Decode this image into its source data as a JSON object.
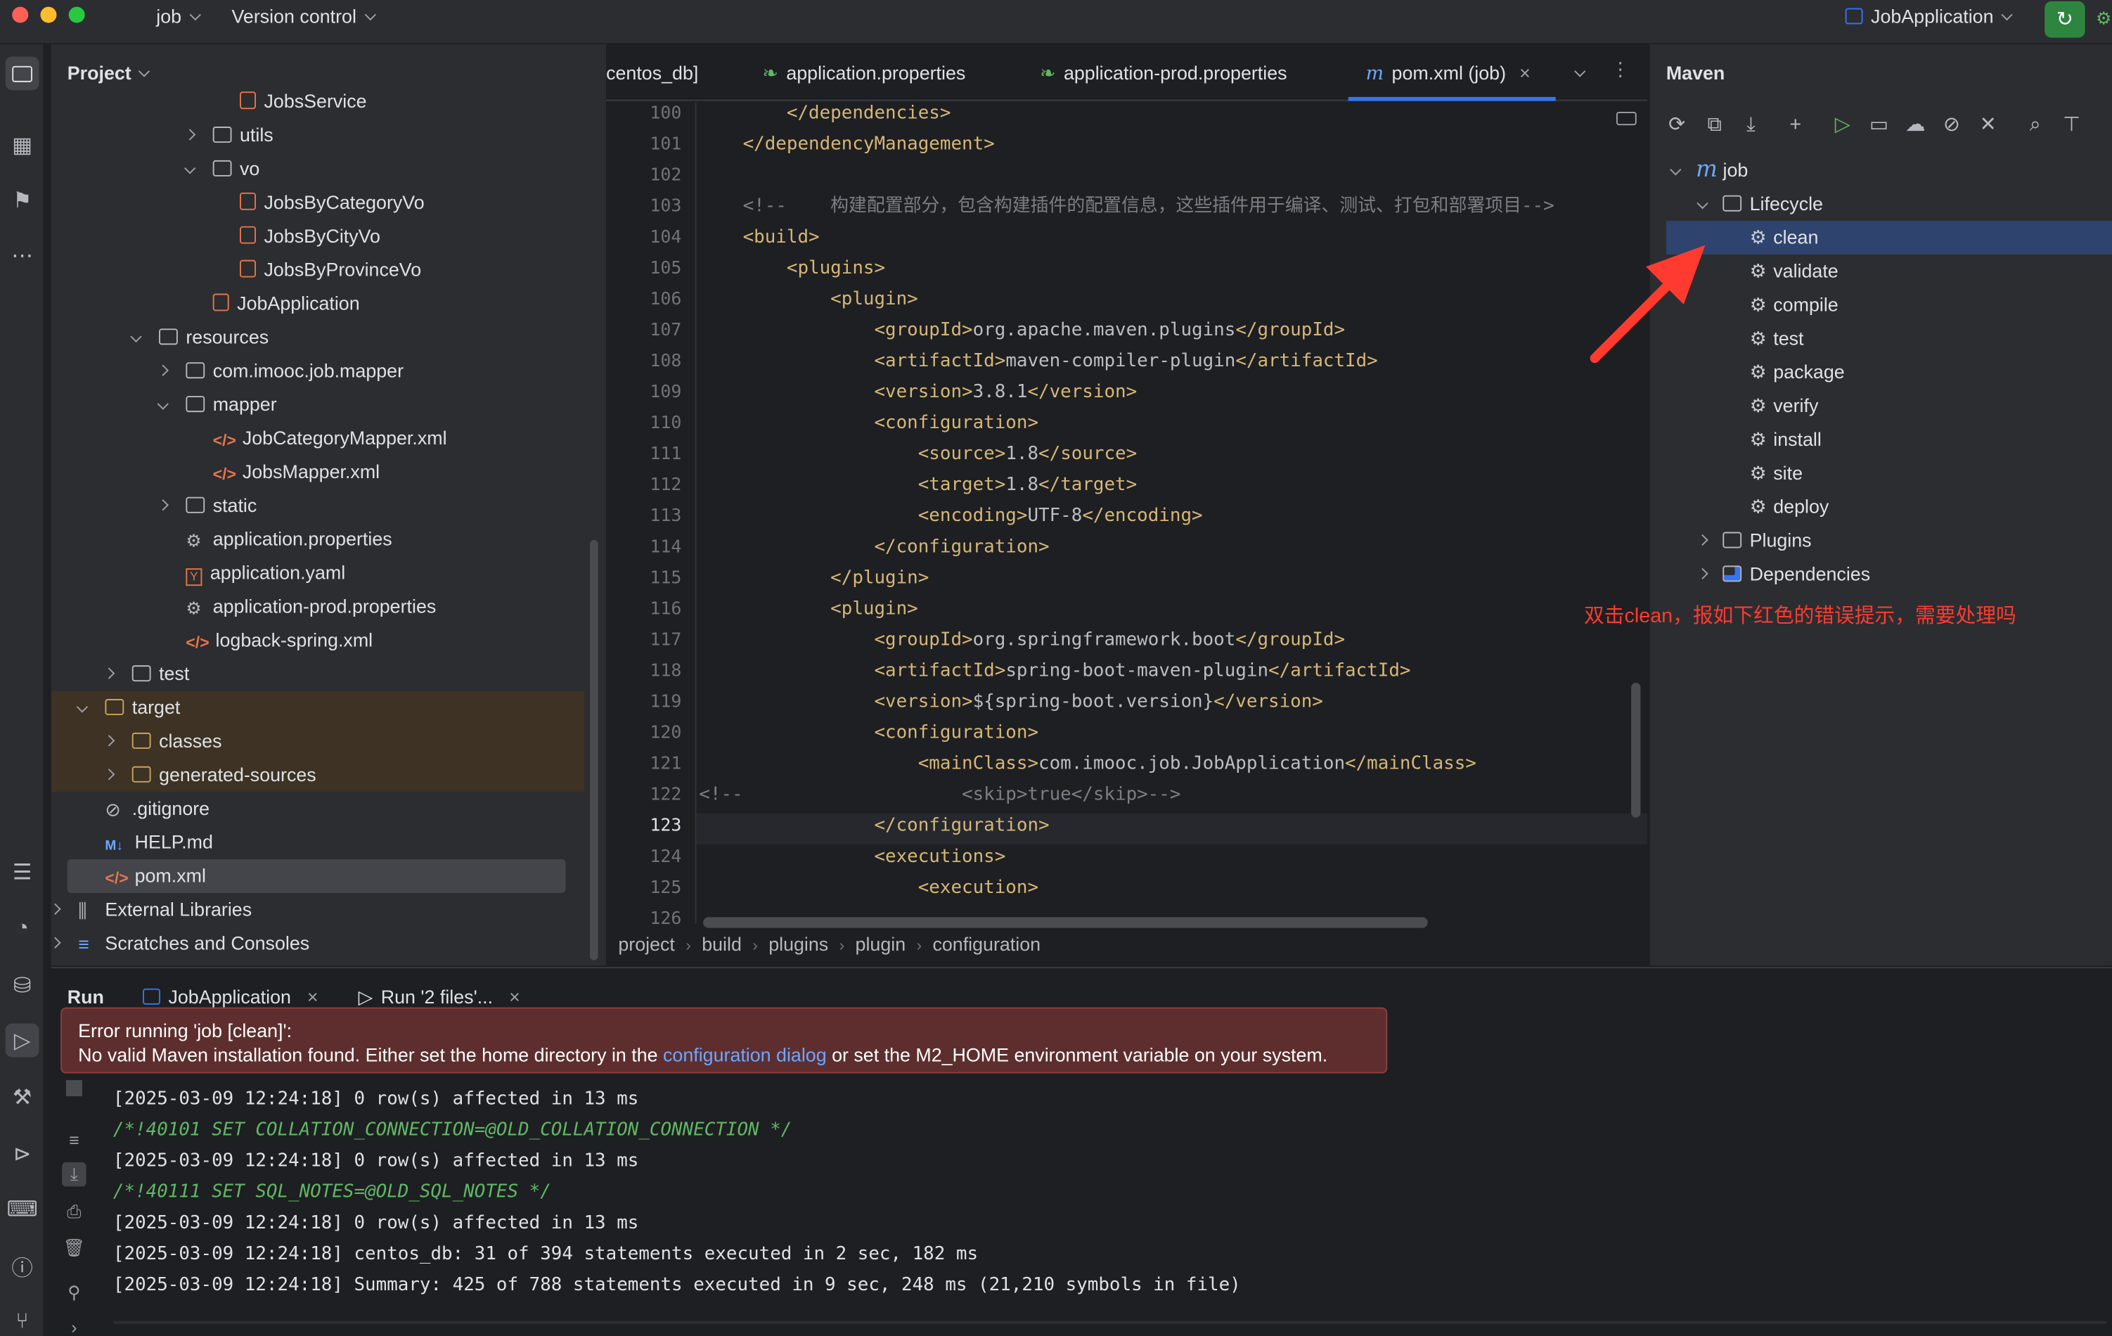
{
  "titlebar": {
    "project_name": "job",
    "vcs_label": "Version control",
    "run_config": "JobApplication"
  },
  "project_panel": {
    "title": "Project",
    "items": [
      {
        "label": "JobsService",
        "type": "java",
        "indent": 7
      },
      {
        "label": "utils",
        "type": "folder",
        "indent": 6,
        "arrow": "right"
      },
      {
        "label": "vo",
        "type": "folder",
        "indent": 6,
        "arrow": "down"
      },
      {
        "label": "JobsByCategoryVo",
        "type": "java",
        "indent": 7
      },
      {
        "label": "JobsByCityVo",
        "type": "java",
        "indent": 7
      },
      {
        "label": "JobsByProvinceVo",
        "type": "java",
        "indent": 7
      },
      {
        "label": "JobApplication",
        "type": "java",
        "indent": 6
      },
      {
        "label": "resources",
        "type": "folder",
        "indent": 4,
        "arrow": "down"
      },
      {
        "label": "com.imooc.job.mapper",
        "type": "folder",
        "indent": 5,
        "arrow": "right"
      },
      {
        "label": "mapper",
        "type": "folder",
        "indent": 5,
        "arrow": "down"
      },
      {
        "label": "JobCategoryMapper.xml",
        "type": "xml",
        "indent": 6
      },
      {
        "label": "JobsMapper.xml",
        "type": "xml",
        "indent": 6
      },
      {
        "label": "static",
        "type": "folder",
        "indent": 5,
        "arrow": "right"
      },
      {
        "label": "application.properties",
        "type": "gear",
        "indent": 5
      },
      {
        "label": "application.yaml",
        "type": "yaml",
        "indent": 5
      },
      {
        "label": "application-prod.properties",
        "type": "gear",
        "indent": 5
      },
      {
        "label": "logback-spring.xml",
        "type": "xml",
        "indent": 5
      },
      {
        "label": "test",
        "type": "folder",
        "indent": 3,
        "arrow": "right"
      },
      {
        "label": "target",
        "type": "folder-o",
        "indent": 2,
        "arrow": "down",
        "highlight": true
      },
      {
        "label": "classes",
        "type": "folder-o",
        "indent": 3,
        "arrow": "right",
        "highlight": true
      },
      {
        "label": "generated-sources",
        "type": "folder-o",
        "indent": 3,
        "arrow": "right",
        "highlight": true
      },
      {
        "label": ".gitignore",
        "type": "ignore",
        "indent": 2
      },
      {
        "label": "HELP.md",
        "type": "md",
        "indent": 2
      },
      {
        "label": "pom.xml",
        "type": "xml",
        "indent": 2,
        "selected": true
      },
      {
        "label": "External Libraries",
        "type": "lib",
        "indent": 1,
        "arrow": "right"
      },
      {
        "label": "Scratches and Consoles",
        "type": "scratch",
        "indent": 1,
        "arrow": "right"
      }
    ]
  },
  "editor": {
    "tabs": [
      {
        "label": "centos_db]"
      },
      {
        "label": "application.properties"
      },
      {
        "label": "application-prod.properties"
      },
      {
        "label": "pom.xml (job)",
        "active": true
      }
    ],
    "lines": [
      {
        "n": "100",
        "text": "        </dependencies>"
      },
      {
        "n": "101",
        "text": "    </dependencyManagement>"
      },
      {
        "n": "102",
        "text": ""
      },
      {
        "n": "103",
        "text": "    <!--    构建配置部分，包含构建插件的配置信息，这些插件用于编译、测试、打包和部署项目-->"
      },
      {
        "n": "104",
        "text": "    <build>"
      },
      {
        "n": "105",
        "text": "        <plugins>"
      },
      {
        "n": "106",
        "text": "            <plugin>"
      },
      {
        "n": "107",
        "text": "                <groupId>org.apache.maven.plugins</groupId>"
      },
      {
        "n": "108",
        "text": "                <artifactId>maven-compiler-plugin</artifactId>"
      },
      {
        "n": "109",
        "text": "                <version>3.8.1</version>"
      },
      {
        "n": "110",
        "text": "                <configuration>"
      },
      {
        "n": "111",
        "text": "                    <source>1.8</source>"
      },
      {
        "n": "112",
        "text": "                    <target>1.8</target>"
      },
      {
        "n": "113",
        "text": "                    <encoding>UTF-8</encoding>"
      },
      {
        "n": "114",
        "text": "                </configuration>"
      },
      {
        "n": "115",
        "text": "            </plugin>"
      },
      {
        "n": "116",
        "text": "            <plugin>"
      },
      {
        "n": "117",
        "text": "                <groupId>org.springframework.boot</groupId>"
      },
      {
        "n": "118",
        "text": "                <artifactId>spring-boot-maven-plugin</artifactId>"
      },
      {
        "n": "119",
        "text": "                <version>${spring-boot.version}</version>"
      },
      {
        "n": "120",
        "text": "                <configuration>"
      },
      {
        "n": "121",
        "text": "                    <mainClass>com.imooc.job.JobApplication</mainClass>"
      },
      {
        "n": "122",
        "text": "<!--                    <skip>true</skip>-->"
      },
      {
        "n": "123",
        "text": "                </configuration>"
      },
      {
        "n": "124",
        "text": "                <executions>"
      },
      {
        "n": "125",
        "text": "                    <execution>"
      },
      {
        "n": "126",
        "text": ""
      }
    ],
    "breadcrumb": [
      "project",
      "build",
      "plugins",
      "plugin",
      "configuration"
    ]
  },
  "maven": {
    "title": "Maven",
    "root": "job",
    "lifecycle_label": "Lifecycle",
    "goals": [
      "clean",
      "validate",
      "compile",
      "test",
      "package",
      "verify",
      "install",
      "site",
      "deploy"
    ],
    "plugins_label": "Plugins",
    "dependencies_label": "Dependencies",
    "annotation": "双击clean，报如下红色的错误提示，需要处理吗"
  },
  "run_panel": {
    "title": "Run",
    "tabs": [
      "JobApplication",
      "Run '2 files'..."
    ],
    "error_title": "Error running 'job [clean]':",
    "error_msg_before": "No valid Maven installation found. Either set the home directory in the ",
    "error_link": "configuration dialog",
    "error_msg_after": " or set the M2_HOME environment variable on your system.",
    "output": [
      {
        "text": "[2025-03-09 12:24:18] 0 row(s) affected in 13 ms",
        "kind": "log"
      },
      {
        "text": "/*!40101 SET COLLATION_CONNECTION=@OLD_COLLATION_CONNECTION */",
        "kind": "sql"
      },
      {
        "text": "[2025-03-09 12:24:18] 0 row(s) affected in 13 ms",
        "kind": "log"
      },
      {
        "text": "/*!40111 SET SQL_NOTES=@OLD_SQL_NOTES */",
        "kind": "sql"
      },
      {
        "text": "[2025-03-09 12:24:18] 0 row(s) affected in 13 ms",
        "kind": "log"
      },
      {
        "text": "[2025-03-09 12:24:18] centos_db: 31 of 394 statements executed in 2 sec, 182 ms",
        "kind": "log"
      },
      {
        "text": "[2025-03-09 12:24:18] Summary: 425 of 788 statements executed in 9 sec, 248 ms (21,210 symbols in file)",
        "kind": "log"
      }
    ]
  },
  "colors": {
    "accent": "#3574f0",
    "selection": "#2e436e",
    "error_bg": "#5e2e2e",
    "annotation_red": "#ff3b30"
  }
}
